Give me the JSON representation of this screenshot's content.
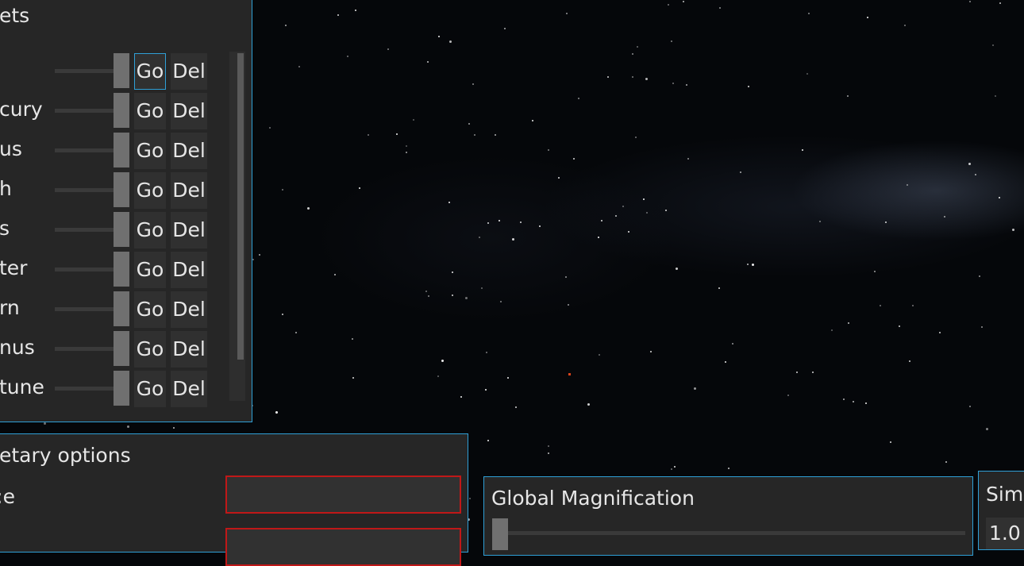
{
  "planets_panel": {
    "title": "ets",
    "go_label": "Go",
    "del_label": "Del",
    "rows": [
      {
        "name": ""
      },
      {
        "name": "cury"
      },
      {
        "name": "us"
      },
      {
        "name": "h"
      },
      {
        "name": "s"
      },
      {
        "name": "ter"
      },
      {
        "name": "rn"
      },
      {
        "name": "nus"
      },
      {
        "name": "tune"
      }
    ]
  },
  "planetary_panel": {
    "title": "etary options",
    "field_label": "e:",
    "field_value": "",
    "second_field_value": ""
  },
  "magnification_panel": {
    "title": "Global Magnification"
  },
  "sim_panel": {
    "title": "Sim",
    "value": "1.0"
  },
  "colors": {
    "panel_bg": "#262626",
    "panel_border": "#2f9fd6",
    "invalid_border": "#c01818",
    "space_bg": "#05070a"
  }
}
